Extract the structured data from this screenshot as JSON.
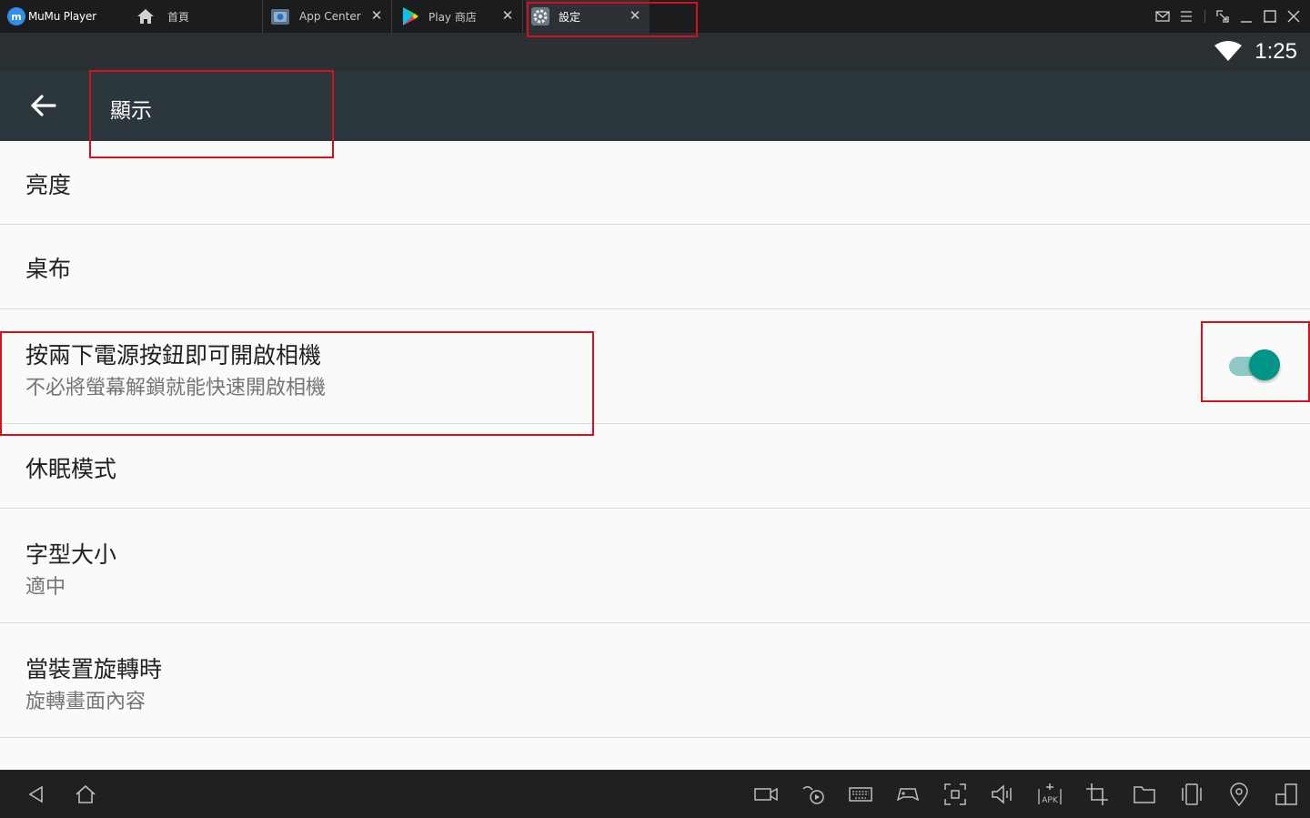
{
  "titlebar": {
    "app_name": "MuMu Player",
    "tabs": [
      {
        "label": "首頁",
        "icon": "home-icon"
      },
      {
        "label": "App Center",
        "icon": "app-center-icon"
      },
      {
        "label": "Play 商店",
        "icon": "play-store-icon"
      },
      {
        "label": "設定",
        "icon": "settings-gear-icon",
        "active": true
      }
    ]
  },
  "statusbar": {
    "time": "1:25",
    "wifi_icon": "wifi-icon"
  },
  "appbar": {
    "title": "顯示"
  },
  "settings": {
    "items": [
      {
        "title": "亮度"
      },
      {
        "title": "桌布"
      },
      {
        "title": "按兩下電源按鈕即可開啟相機",
        "subtitle": "不必將螢幕解鎖就能快速開啟相機",
        "toggle_on": true
      },
      {
        "title": "休眠模式"
      },
      {
        "title": "字型大小",
        "subtitle": "適中"
      },
      {
        "title": "當裝置旋轉時",
        "subtitle": "旋轉畫面內容"
      }
    ]
  },
  "colors": {
    "accent": "#009587",
    "appbar": "#2c373d",
    "highlight": "#d5101c"
  }
}
